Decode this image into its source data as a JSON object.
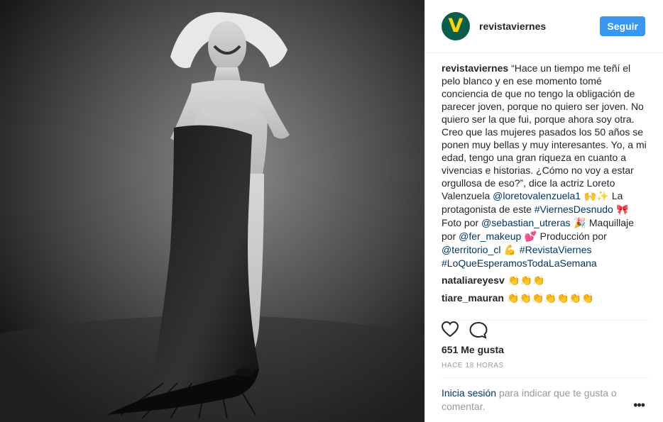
{
  "post": {
    "username": "revistaviernes",
    "follow_label": "Seguir",
    "caption_user": "revistaviernes",
    "caption_text": " “Hace un tiempo me teñí el pelo blanco y en ese momento tomé conciencia de que no tengo la obligación de parecer joven, porque no quiero ser joven. No quiero ser la que fui, porque ahora soy otra. Creo que las mujeres pasados los 50 años se ponen muy bellas y muy interesantes. Yo, a mi edad, tengo una gran riqueza en cuanto a vivencias e historias. ¿Cómo no voy a estar orgullosa de eso?”, dice la actriz Loreto Valenzuela ",
    "mention1": "@loretovalenzuela1",
    "emoji1": " 🙌✨ ",
    "text2": "La protagonista de este ",
    "hashtag1": "#ViernesDesnudo",
    "emoji2": " 🎀 ",
    "text3": "Foto por ",
    "mention2": "@sebastian_utreras",
    "emoji3": " 🎉 ",
    "text4": "Maquillaje por ",
    "mention3": "@fer_makeup",
    "emoji4": " 💕 ",
    "text5": "Producción por ",
    "mention4": "@territorio_cl",
    "emoji5": " 💪 ",
    "hashtag2": "#RevistaViernes",
    "hashtag3": "#LoQueEsperamosTodaLaSemana",
    "comments": [
      {
        "user": "natali­areyesv",
        "text": " 👏👏👏"
      },
      {
        "user": "tiare_mauran",
        "text": " 👏👏👏👏👏👏👏"
      }
    ],
    "likes": "651 Me gusta",
    "time": "HACE 18 HORAS",
    "login_link": "Inicia sesión",
    "login_text": " para indicar que te gusta o comentar.",
    "more_label": "•••"
  }
}
